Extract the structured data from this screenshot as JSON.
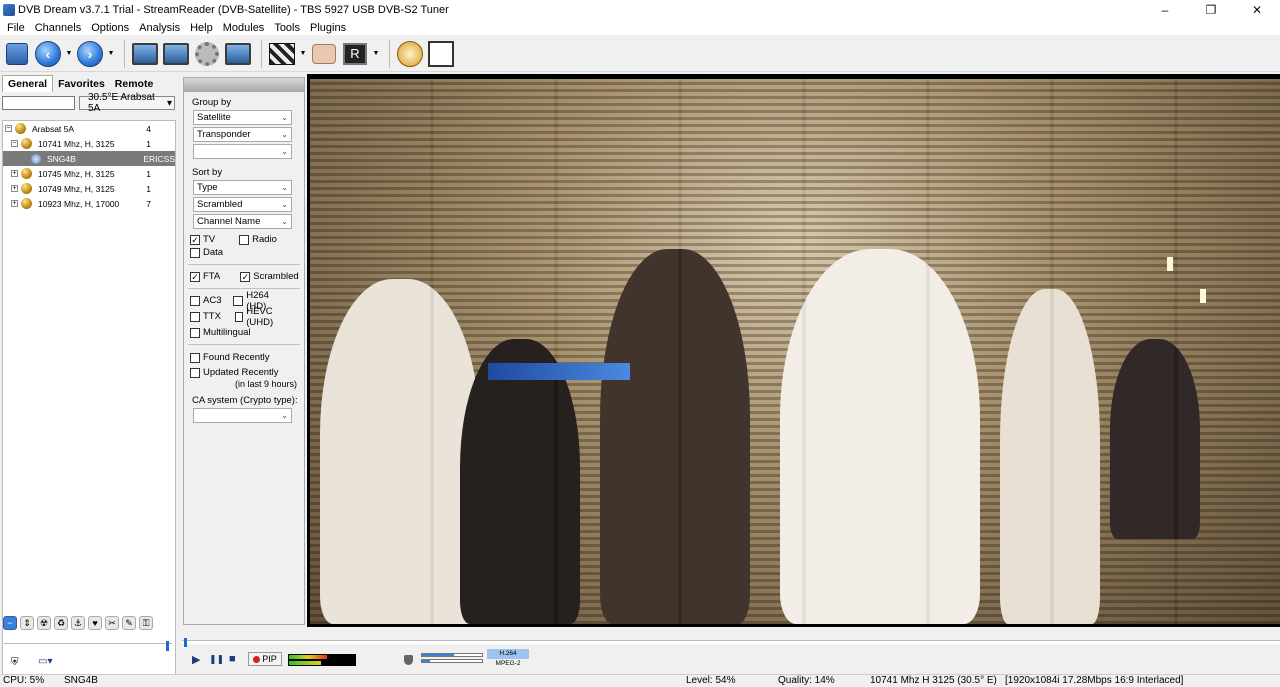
{
  "window": {
    "title": "DVB Dream v3.7.1 Trial - StreamReader (DVB-Satellite)  -  TBS 5927 USB DVB-S2 Tuner",
    "minimize": "–",
    "maximize": "❐",
    "close": "✕"
  },
  "menu": [
    "File",
    "Channels",
    "Options",
    "Analysis",
    "Help",
    "Modules",
    "Tools",
    "Plugins"
  ],
  "toolbar": {
    "buttons": [
      "database-icon",
      "back-icon",
      "forward-icon",
      "monitor-icon",
      "window-icon",
      "gear-icon",
      "screenshot-icon",
      "clapper-icon",
      "eraser-icon",
      "record-icon",
      "timer-icon",
      "epg-icon"
    ],
    "record_label": "R"
  },
  "left_panel": {
    "tabs": [
      "General",
      "Favorites",
      "Remote"
    ],
    "active_tab": "General",
    "filter_value": "",
    "satellite_select": "30.5°E Arabsat 5A",
    "tree": [
      {
        "level": 0,
        "expander": "−",
        "label": "Arabsat 5A",
        "count": "4",
        "icon": "satellite-ball"
      },
      {
        "level": 1,
        "expander": "−",
        "label": "10741 Mhz, H, 3125",
        "count": "1",
        "icon": "transponder-ball"
      },
      {
        "level": 2,
        "expander": "",
        "label": "SNG4B",
        "count": "ERICSS",
        "icon": "channel-icon",
        "selected": true
      },
      {
        "level": 1,
        "expander": "+",
        "label": "10745 Mhz, H, 3125",
        "count": "1",
        "icon": "transponder-ball"
      },
      {
        "level": 1,
        "expander": "+",
        "label": "10749 Mhz, H, 3125",
        "count": "1",
        "icon": "transponder-ball"
      },
      {
        "level": 1,
        "expander": "+",
        "label": "10923 Mhz, H, 17000",
        "count": "7",
        "icon": "transponder-ball"
      }
    ]
  },
  "filter_panel": {
    "group_by_label": "Group by",
    "group_by": [
      "Satellite",
      "Transponder",
      ""
    ],
    "sort_by_label": "Sort by",
    "sort_by": [
      "Type",
      "Scrambled",
      "Channel Name"
    ],
    "types": [
      {
        "label": "TV",
        "checked": true
      },
      {
        "label": "Radio",
        "checked": false
      },
      {
        "label": "Data",
        "checked": false
      }
    ],
    "access": [
      {
        "label": "FTA",
        "checked": true
      },
      {
        "label": "Scrambled",
        "checked": true
      }
    ],
    "features": [
      {
        "label": "AC3",
        "checked": false
      },
      {
        "label": "H264 (HD)",
        "checked": false
      },
      {
        "label": "TTX",
        "checked": false
      },
      {
        "label": "HEVC (UHD)",
        "checked": false
      },
      {
        "label": "Multilingual",
        "checked": false
      }
    ],
    "found_recently": "Found Recently",
    "updated_recently": "Updated Recently",
    "updated_note": "(in last 9 hours)",
    "ca_label": "CA system (Crypto type):",
    "ca_value": ""
  },
  "playback": {
    "play": "▶",
    "pause": "❚❚",
    "stop": "■",
    "pip_label": "PIP",
    "codec_top": "H.264",
    "codec_bottom": "MPEG-2",
    "progress": 0.002
  },
  "status": {
    "cpu": "CPU: 5%",
    "channel": "SNG4B",
    "level": "Level: 54%",
    "quality": "Quality: 14%",
    "tuning": "10741 Mhz  H  3125  (30.5° E)",
    "stream": "[1920x1084i  17.28Mbps  16:9 Interlaced]"
  },
  "colors": {
    "accent": "#3a7fd8",
    "selection": "#7a7a7a"
  }
}
